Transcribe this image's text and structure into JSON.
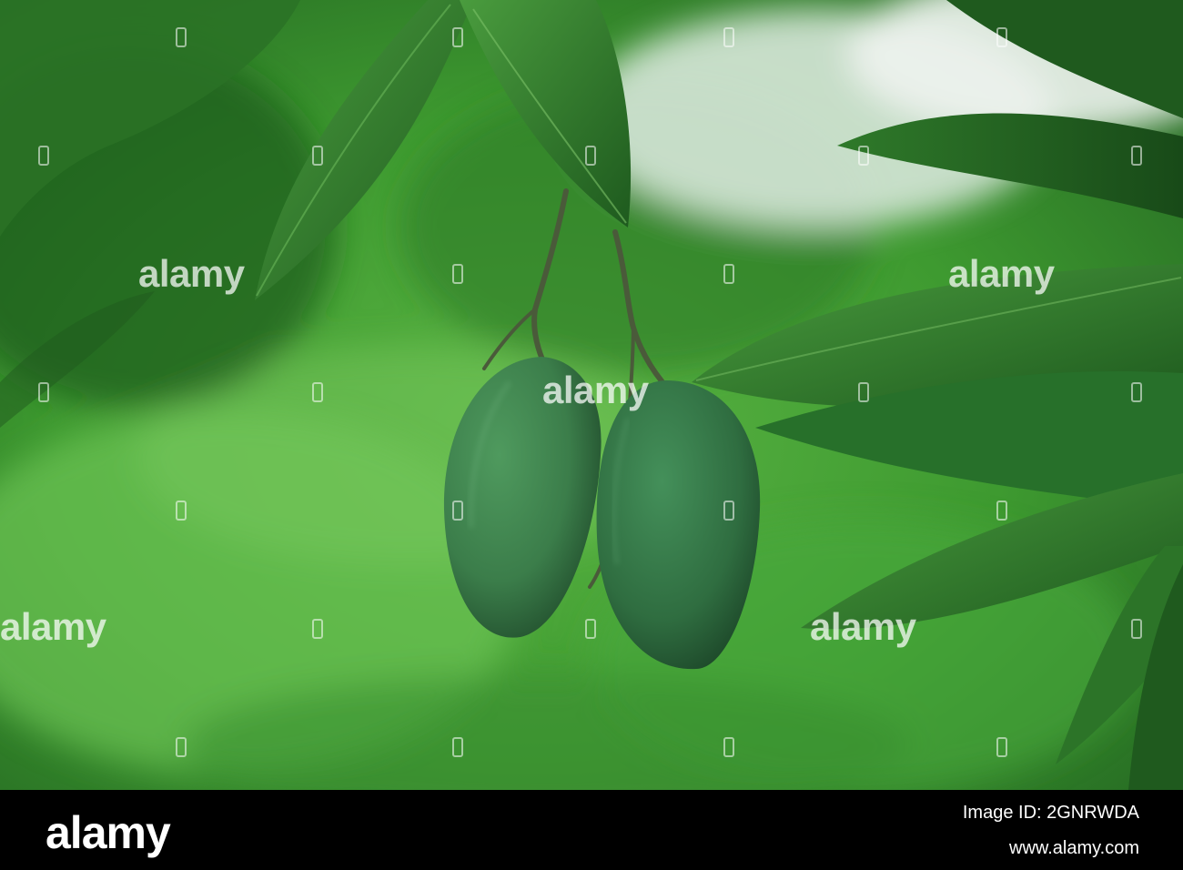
{
  "watermark": {
    "text": "alamy"
  },
  "footer": {
    "brand": "alamy",
    "image_id_label": "Image ID: 2GNRWDA",
    "site": "www.alamy.com"
  },
  "colors": {
    "background_green": "#3f9a32",
    "mango": "#3b7d4a",
    "leaf": "#2e7a2c",
    "footer_bg": "#000000"
  }
}
